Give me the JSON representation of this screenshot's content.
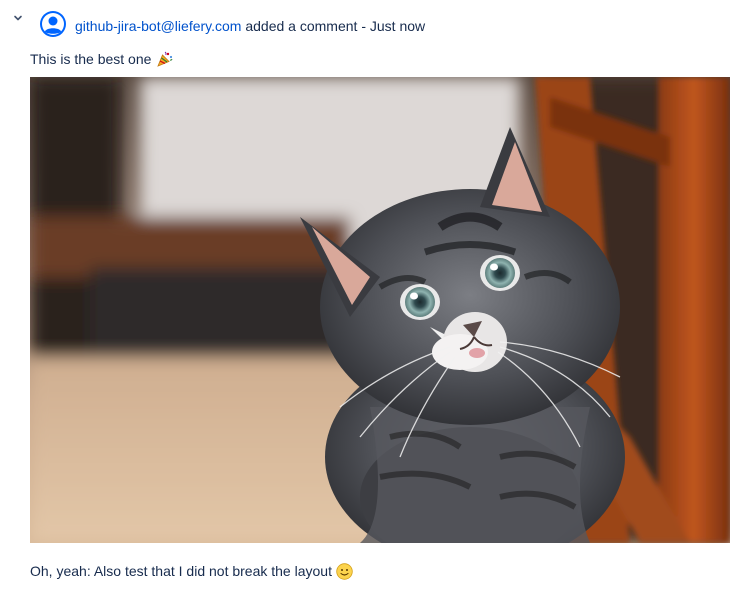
{
  "comment": {
    "author": "github-jira-bot@liefery.com",
    "action": "added a comment",
    "separator": "-",
    "time": "Just now",
    "text": "This is the best one",
    "emoji_icon": "party-popper-icon",
    "footer_text": "Oh, yeah: Also test that I did not break the layout",
    "footer_emoji_icon": "smiley-face-icon"
  },
  "colors": {
    "link": "#0052cc",
    "text": "#172b4d"
  }
}
